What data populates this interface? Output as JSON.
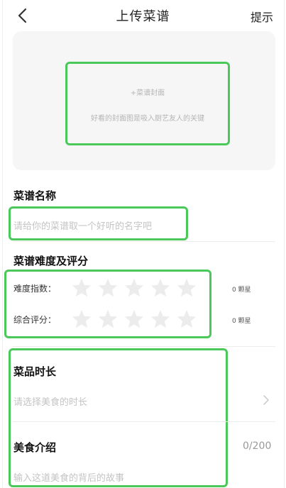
{
  "header": {
    "title": "上传菜谱",
    "hint_label": "提示"
  },
  "cover": {
    "add_label": "+菜谱封面",
    "description": "好看的封面图是吸入厨艺友人的关键"
  },
  "recipe_name": {
    "section_title": "菜谱名称",
    "placeholder": "请给你的菜谱取一个好听的名字吧"
  },
  "difficulty": {
    "section_title": "菜谱难度及评分",
    "rows": [
      {
        "label": "难度指数：",
        "stars_total": 5,
        "stars_selected": 0,
        "count_text": "0 颗星"
      },
      {
        "label": "综合评分：",
        "stars_total": 5,
        "stars_selected": 0,
        "count_text": "0 颗星"
      }
    ]
  },
  "duration": {
    "section_title": "菜品时长",
    "placeholder": "请选择美食的时长"
  },
  "intro": {
    "section_title": "美食介绍",
    "counter": "0/200",
    "placeholder": "输入这道美食的背后的故事"
  },
  "colors": {
    "highlight_border": "#4bc85a",
    "star_empty": "#ececec",
    "placeholder_text": "#c4c4c4"
  },
  "icons": {
    "back": "back-icon",
    "chevron": "chevron-right-icon",
    "star": "star-icon"
  }
}
